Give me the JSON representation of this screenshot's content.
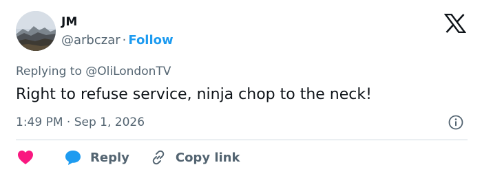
{
  "author": {
    "name": "JM",
    "handle": "@arbczar",
    "separator": "·",
    "follow_label": "Follow"
  },
  "reply_context": {
    "prefix": "Replying to",
    "mention": "@OliLondonTV"
  },
  "tweet": {
    "text": "Right to refuse service, ninja chop to the neck!",
    "time": "1:49 PM",
    "separator": "·",
    "date": "Sep 1, 2026"
  },
  "actions": {
    "reply_label": "Reply",
    "copy_link_label": "Copy link"
  },
  "colors": {
    "like": "#f91880",
    "reply_bubble": "#1d9bf0",
    "follow": "#1d9bf0",
    "secondary_text": "#536471",
    "primary_text": "#0f1419",
    "divider": "#cfd9de"
  },
  "icons": [
    "x-logo-icon",
    "info-icon",
    "heart-icon",
    "reply-bubble-icon",
    "link-icon"
  ]
}
